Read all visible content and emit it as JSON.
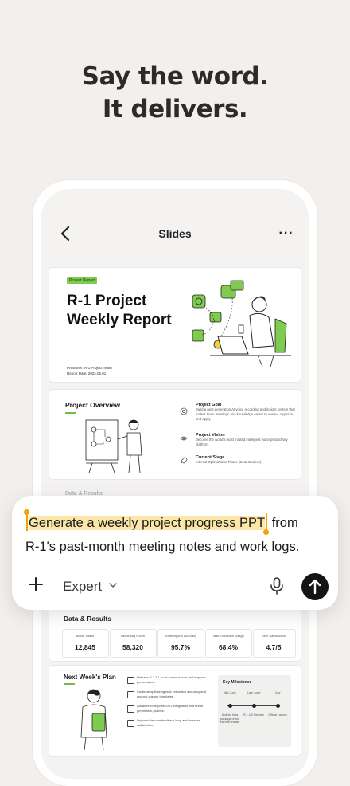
{
  "headline": {
    "line1": "Say the word.",
    "line2": "It delivers."
  },
  "nav": {
    "title": "Slides",
    "more": "···"
  },
  "slide1": {
    "tag": "Project Report",
    "title_line1": "R-1 Project",
    "title_line2": "Weekly Report",
    "presenter": "Presenter: R-1 Project Team",
    "report_date": "Report Date: 2024.06.01"
  },
  "slide2": {
    "title": "Project Overview",
    "items": [
      {
        "heading": "Project Goal",
        "text": "Build a next-generation AI voice recording and insight system that makes team meetings and knowledge easier to review, organize, and apply."
      },
      {
        "heading": "Project Vision",
        "text": "Become the world's most trusted intelligent voice productivity platform."
      },
      {
        "heading": "Current Stage",
        "text": "Internal Optimization Phase (Beta Iteration)"
      }
    ],
    "next_peek": "Data & Results"
  },
  "slide3": {
    "title": "Data & Results",
    "stats": [
      {
        "label": "Active Users",
        "value": "12,845"
      },
      {
        "label": "Recording Hours",
        "value": "58,320"
      },
      {
        "label": "Transcription Accuracy",
        "value": "95.7%"
      },
      {
        "label": "Task Extraction Usage",
        "value": "68.4%"
      },
      {
        "label": "User Satisfaction",
        "value": "4.7/5"
      }
    ]
  },
  "slide4": {
    "title": "Next Week's Plan",
    "plans": [
      "Release R-1.3.1 to fix known issues and improve performance.",
      "Continue optimizing task extraction accuracy and support custom templates.",
      "Advance Enterprise SSO integration and refine permission policies.",
      "Improve the user feedback loop and increase satisfaction."
    ],
    "milestones": {
      "title": "Key Milestones",
      "dates": [
        "Mid-June",
        "Late June",
        "July"
      ],
      "labels": [
        "Android beta package online Internal release",
        "R-1.4.0 Release",
        "Official Launch"
      ]
    }
  },
  "prompt": {
    "highlighted": "Generate a weekly project progress PPT",
    "rest_line1": " from",
    "rest_line2": "R-1's past-month meeting notes and work logs.",
    "mode": "Expert"
  },
  "colors": {
    "background": "#f2efec",
    "accent_green": "#7ecb4f",
    "highlight": "#fde7a8",
    "caret": "#f0a400",
    "send_button": "#141414"
  }
}
